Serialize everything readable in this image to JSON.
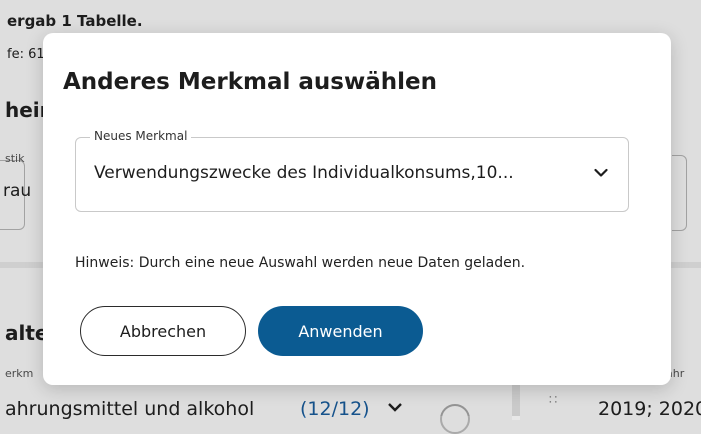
{
  "background": {
    "title": "ergab 1 Tabelle.",
    "subtitle": "fe: 61",
    "section_heading": "heir",
    "field_label": "stik",
    "field_value": "rau",
    "section2_heading": "alte",
    "field2_label": "erkm",
    "row_value": "ahrungsmittel und alkohol",
    "row_count": "(12/12)",
    "drag_handle": "∷",
    "year_label": "ahr",
    "year_value": "2019; 2020"
  },
  "dialog": {
    "title": "Anderes Merkmal auswählen",
    "select": {
      "label": "Neues Merkmal",
      "value": "Verwendungszwecke des Individualkonsums,10..."
    },
    "hint": "Hinweis: Durch eine neue Auswahl werden neue Daten geladen.",
    "cancel_label": "Abbrechen",
    "apply_label": "Anwenden"
  },
  "colors": {
    "primary": "#0b5b92",
    "link": "#1a5fa0"
  },
  "icons": {
    "select_chevron": "chevron-down-icon",
    "row_chevron": "chevron-down-icon"
  }
}
